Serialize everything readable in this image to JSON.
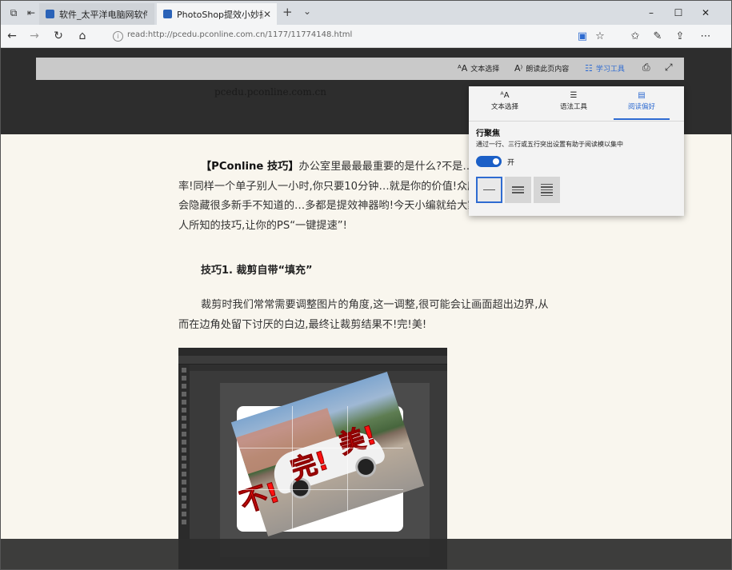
{
  "browser": {
    "tabs": [
      {
        "title": "软件_太平洋电脑网软件资讯",
        "active": false
      },
      {
        "title": "PhotoShop提效小妙招!",
        "active": true
      }
    ],
    "new_tab": "+",
    "tab_list": "⌄",
    "url": "read:http://pcedu.pconline.com.cn/1177/11774148.html",
    "window_controls": {
      "minimize": "–",
      "maximize": "☐",
      "close": "✕"
    }
  },
  "reading_toolbar": {
    "text_options": "文本选择",
    "read_aloud": "朗读此页内容",
    "learning_tools": "学习工具"
  },
  "site_name": "pcedu.pconline.com.cn",
  "article": {
    "intro_bold": "【PConline 技巧】",
    "intro_text": "办公室里最最最重要的是什么?不是…果,而是——效率!同样一个单子别人一小时,你只要10分钟…就是你的价值!众所周知,PS里常常会隐藏很多新手不知道的…多都是提效神器哟!今天小编就给大家介绍几招不为人所知的技巧,让你的PS“一键提速”!",
    "heading": "技巧1. 裁剪自带“填充”",
    "para2": "裁剪时我们常常需要调整图片的角度,这一调整,很可能会让画面超出边界,从而在边角处留下讨厌的白边,最终让裁剪结果不!完!美!",
    "stamps": [
      "不!",
      "完!",
      "美!"
    ]
  },
  "popup": {
    "tabs": [
      {
        "label": "文本选择",
        "icon": "text-options-icon"
      },
      {
        "label": "语法工具",
        "icon": "grammar-tools-icon"
      },
      {
        "label": "阅读偏好",
        "icon": "reading-preferences-icon"
      }
    ],
    "title": "行聚焦",
    "description": "通过一行、三行或五行突出设置有助于阅读模以集中",
    "toggle_label": "开",
    "toggle_on": true,
    "line_options": [
      "one-line",
      "three-lines",
      "five-lines"
    ],
    "selected_line_option": "one-line"
  },
  "colors": {
    "accent": "#2e6bd1",
    "dark_bg": "#2d2d2d",
    "page_bg": "#f9f6ee"
  }
}
